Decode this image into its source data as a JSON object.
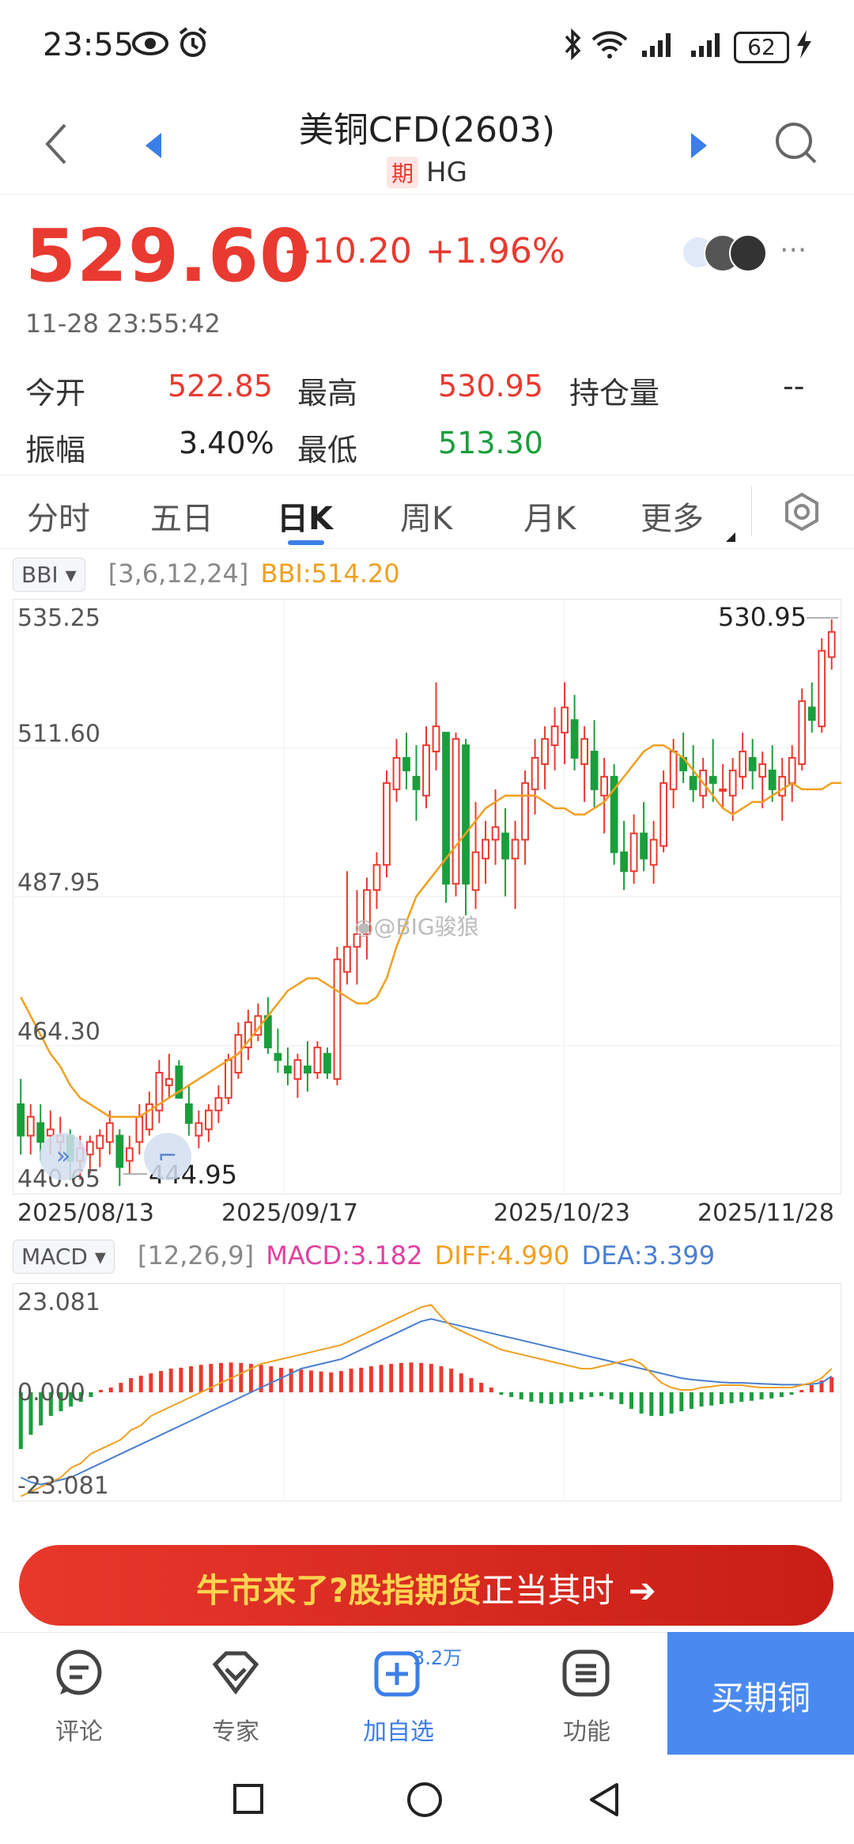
{
  "status_bar": {
    "time": "23:55",
    "battery": "62"
  },
  "header": {
    "title": "美铜CFD(2603)",
    "badge": "期",
    "symbol": "HG"
  },
  "quote": {
    "price": "529.60",
    "change": "+10.20",
    "change_pct": "+1.96%",
    "datetime": "11-28 23:55:42",
    "open_label": "今开",
    "open": "522.85",
    "high_label": "最高",
    "high": "530.95",
    "oi_label": "持仓量",
    "oi": "--",
    "amp_label": "振幅",
    "amp": "3.40%",
    "low_label": "最低",
    "low": "513.30"
  },
  "tabs": [
    "分时",
    "五日",
    "日K",
    "周K",
    "月K",
    "更多"
  ],
  "active_tab": "日K",
  "kline": {
    "indicator": "BBI",
    "params": "[3,6,12,24]",
    "value_text": "BBI:514.20",
    "max_label": "530.95",
    "min_label": "444.95",
    "watermark": "@BIG骏狼"
  },
  "macd": {
    "indicator": "MACD",
    "params": "[12,26,9]",
    "macd_text": "MACD:3.182",
    "diff_text": "DIFF:4.990",
    "dea_text": "DEA:3.399"
  },
  "banner": {
    "part1": "牛市来了?",
    "part2": "股指期货",
    "part3": "正当其时",
    "arrow": "➔"
  },
  "bottom_nav": {
    "comment": "评论",
    "expert": "专家",
    "add": "加自选",
    "add_count": "3.2万",
    "func": "功能",
    "buy": "买期铜"
  },
  "colors": {
    "up": "#e83a30",
    "down": "#1a9e3c",
    "bbi": "#f0a020",
    "macd": "#e040a0",
    "diff": "#f0a020",
    "dea": "#4a7fd0",
    "accent": "#3b7ee8"
  },
  "chart_data": [
    {
      "type": "candlestick",
      "title": "",
      "y_ticks": [
        535.25,
        511.6,
        487.95,
        464.3,
        440.65
      ],
      "ylim": [
        440.65,
        535.25
      ],
      "x_ticks": [
        "2025/08/13",
        "2025/09/17",
        "2025/10/23",
        "2025/11/28"
      ],
      "grid": true,
      "series": [
        {
          "name": "BBI",
          "values": [
            472,
            469,
            466,
            463,
            461,
            458,
            456,
            455,
            454,
            453,
            453,
            453,
            453,
            454,
            455,
            456,
            457,
            458,
            459,
            460,
            461,
            462,
            463,
            465,
            467,
            469,
            471,
            473,
            474,
            475,
            475,
            474,
            473,
            472,
            471,
            471,
            472,
            475,
            480,
            484,
            488,
            490,
            492,
            494,
            496,
            498,
            500,
            502,
            503,
            504,
            504,
            504,
            504,
            503,
            502,
            502,
            501,
            501,
            502,
            503,
            505,
            507,
            509,
            511,
            512,
            512,
            511,
            510,
            508,
            506,
            504,
            502,
            501,
            502,
            503,
            503,
            504,
            505,
            506,
            505,
            505,
            505,
            506,
            506,
            507,
            508,
            510,
            514
          ]
        },
        {
          "name": "candles",
          "values": [
            [
              455,
              459,
              447,
              450
            ],
            [
              450,
              455,
              447,
              453
            ],
            [
              452,
              455,
              446,
              449
            ],
            [
              450,
              454,
              447,
              451
            ],
            [
              449,
              453,
              446,
              450
            ],
            [
              450,
              451,
              443,
              446
            ],
            [
              446,
              450,
              443,
              448
            ],
            [
              447,
              450,
              444,
              449
            ],
            [
              448,
              451,
              445,
              450
            ],
            [
              449,
              454,
              447,
              452
            ],
            [
              450,
              451,
              442,
              445
            ],
            [
              446,
              450,
              444,
              448
            ],
            [
              449,
              455,
              447,
              453
            ],
            [
              451,
              457,
              450,
              455
            ],
            [
              454,
              462,
              452,
              460
            ],
            [
              458,
              463,
              456,
              459
            ],
            [
              461,
              462,
              456,
              456
            ],
            [
              455,
              458,
              450,
              452
            ],
            [
              450,
              454,
              448,
              452
            ],
            [
              451,
              455,
              449,
              454
            ],
            [
              454,
              458,
              452,
              456
            ],
            [
              456,
              463,
              455,
              462
            ],
            [
              460,
              468,
              459,
              466
            ],
            [
              464,
              470,
              462,
              468
            ],
            [
              466,
              471,
              465,
              469
            ],
            [
              469,
              472,
              463,
              464
            ],
            [
              463,
              467,
              460,
              462
            ],
            [
              461,
              464,
              458,
              460
            ],
            [
              459,
              463,
              456,
              462
            ],
            [
              461,
              465,
              457,
              460
            ],
            [
              460,
              465,
              459,
              464
            ],
            [
              463,
              464,
              459,
              460
            ],
            [
              459,
              480,
              458,
              478
            ],
            [
              476,
              492,
              474,
              480
            ],
            [
              480,
              489,
              474,
              482
            ],
            [
              482,
              491,
              478,
              489
            ],
            [
              489,
              495,
              486,
              493
            ],
            [
              493,
              508,
              491,
              506
            ],
            [
              505,
              513,
              503,
              510
            ],
            [
              510,
              514,
              505,
              508
            ],
            [
              507,
              512,
              500,
              505
            ],
            [
              504,
              515,
              502,
              512
            ],
            [
              511,
              522,
              508,
              515
            ],
            [
              514,
              513,
              487,
              490
            ],
            [
              490,
              514,
              488,
              513
            ],
            [
              512,
              513,
              485,
              490
            ],
            [
              489,
              503,
              486,
              495
            ],
            [
              494,
              500,
              490,
              497
            ],
            [
              497,
              505,
              493,
              499
            ],
            [
              498,
              502,
              488,
              494
            ],
            [
              494,
              500,
              486,
              497
            ],
            [
              497,
              508,
              493,
              506
            ],
            [
              505,
              513,
              501,
              510
            ],
            [
              509,
              515,
              505,
              513
            ],
            [
              512,
              518,
              508,
              515
            ],
            [
              514,
              522,
              509,
              518
            ],
            [
              516,
              520,
              508,
              510
            ],
            [
              509,
              515,
              503,
              513
            ],
            [
              511,
              516,
              502,
              505
            ],
            [
              504,
              510,
              498,
              507
            ],
            [
              507,
              509,
              493,
              495
            ],
            [
              495,
              500,
              489,
              492
            ],
            [
              492,
              501,
              490,
              498
            ],
            [
              498,
              503,
              492,
              494
            ],
            [
              493,
              500,
              490,
              497
            ],
            [
              496,
              508,
              495,
              506
            ],
            [
              505,
              513,
              502,
              511
            ],
            [
              510,
              514,
              506,
              508
            ],
            [
              507,
              512,
              503,
              505
            ],
            [
              504,
              510,
              502,
              508
            ],
            [
              507,
              513,
              503,
              506
            ],
            [
              505,
              509,
              502,
              505
            ],
            [
              504,
              510,
              500,
              508
            ],
            [
              507,
              514,
              505,
              511
            ],
            [
              510,
              513,
              505,
              508
            ],
            [
              507,
              511,
              502,
              509
            ],
            [
              508,
              512,
              503,
              505
            ],
            [
              504,
              510,
              500,
              507
            ],
            [
              506,
              512,
              503,
              510
            ],
            [
              509,
              521,
              508,
              519
            ],
            [
              518,
              522,
              514,
              516
            ],
            [
              515,
              529,
              514,
              527
            ],
            [
              526,
              532,
              524,
              530
            ]
          ]
        }
      ],
      "max_label": 530.95,
      "min_label": 444.95
    },
    {
      "type": "bar+line",
      "title": "",
      "y_ticks": [
        23.081,
        0.0,
        -23.081
      ],
      "ylim": [
        -23.081,
        23.081
      ],
      "grid": true,
      "series": [
        {
          "name": "MACD",
          "values": [
            -12,
            -9,
            -7,
            -5,
            -4,
            -3,
            -2,
            -1,
            0.5,
            1,
            2,
            3,
            3.5,
            4,
            4.5,
            5,
            5.2,
            5.5,
            5.8,
            6,
            6.2,
            6.3,
            6.2,
            6,
            5.8,
            5.5,
            5.2,
            5,
            4.8,
            4.6,
            4.4,
            4.2,
            4.5,
            5,
            5.2,
            5.5,
            5.8,
            6,
            6.2,
            6.3,
            6.2,
            6,
            5.5,
            5,
            4,
            3,
            2,
            1,
            -0.5,
            -1,
            -1.5,
            -2,
            -2.3,
            -2.5,
            -2.3,
            -2,
            -1.5,
            -1,
            -0.8,
            -1.5,
            -2.5,
            -3.5,
            -4.5,
            -5,
            -5,
            -4.5,
            -4,
            -3.5,
            -3,
            -2.8,
            -2.5,
            -2.3,
            -2,
            -1.8,
            -1.5,
            -1.3,
            -1,
            -0.5,
            0.5,
            1.5,
            2.5,
            3.2
          ]
        },
        {
          "name": "DIFF",
          "values": [
            -22,
            -21,
            -20,
            -19,
            -18,
            -16,
            -15,
            -13,
            -12,
            -11,
            -10,
            -8,
            -7,
            -5,
            -4,
            -3,
            -2,
            -1,
            0,
            1,
            2,
            3,
            4,
            5,
            6,
            6.5,
            7,
            7.5,
            8,
            8.5,
            9,
            9.5,
            10,
            11,
            12,
            13,
            14,
            15,
            16,
            17,
            18,
            18.5,
            16,
            14,
            13,
            12,
            11,
            10,
            9,
            8.5,
            8,
            7.5,
            7,
            6.5,
            6,
            5.5,
            5,
            5,
            5.5,
            6,
            6.5,
            7,
            6,
            4,
            2,
            1,
            0.5,
            0.5,
            1,
            1.2,
            1.5,
            1.5,
            1.5,
            1.2,
            1,
            1,
            1,
            1,
            1.5,
            2,
            3,
            5
          ]
        },
        {
          "name": "DEA",
          "values": [
            -18,
            -19,
            -19.5,
            -19,
            -18.5,
            -18,
            -17,
            -16,
            -15,
            -14,
            -13,
            -12,
            -11,
            -10,
            -9,
            -8,
            -7,
            -6,
            -5,
            -4,
            -3,
            -2,
            -1,
            0,
            1,
            2,
            3,
            4,
            5,
            5.5,
            6,
            6.5,
            7,
            8,
            9,
            10,
            11,
            12,
            13,
            14,
            15,
            15.5,
            15,
            14.5,
            14,
            13.5,
            13,
            12.5,
            12,
            11.5,
            11,
            10.5,
            10,
            9.5,
            9,
            8.5,
            8,
            7.5,
            7,
            6.5,
            6,
            5.5,
            5,
            4.5,
            4,
            3.5,
            3,
            2.7,
            2.5,
            2.3,
            2.1,
            2,
            2,
            1.9,
            1.8,
            1.7,
            1.6,
            1.6,
            1.6,
            1.7,
            2,
            3.4
          ]
        }
      ]
    }
  ]
}
